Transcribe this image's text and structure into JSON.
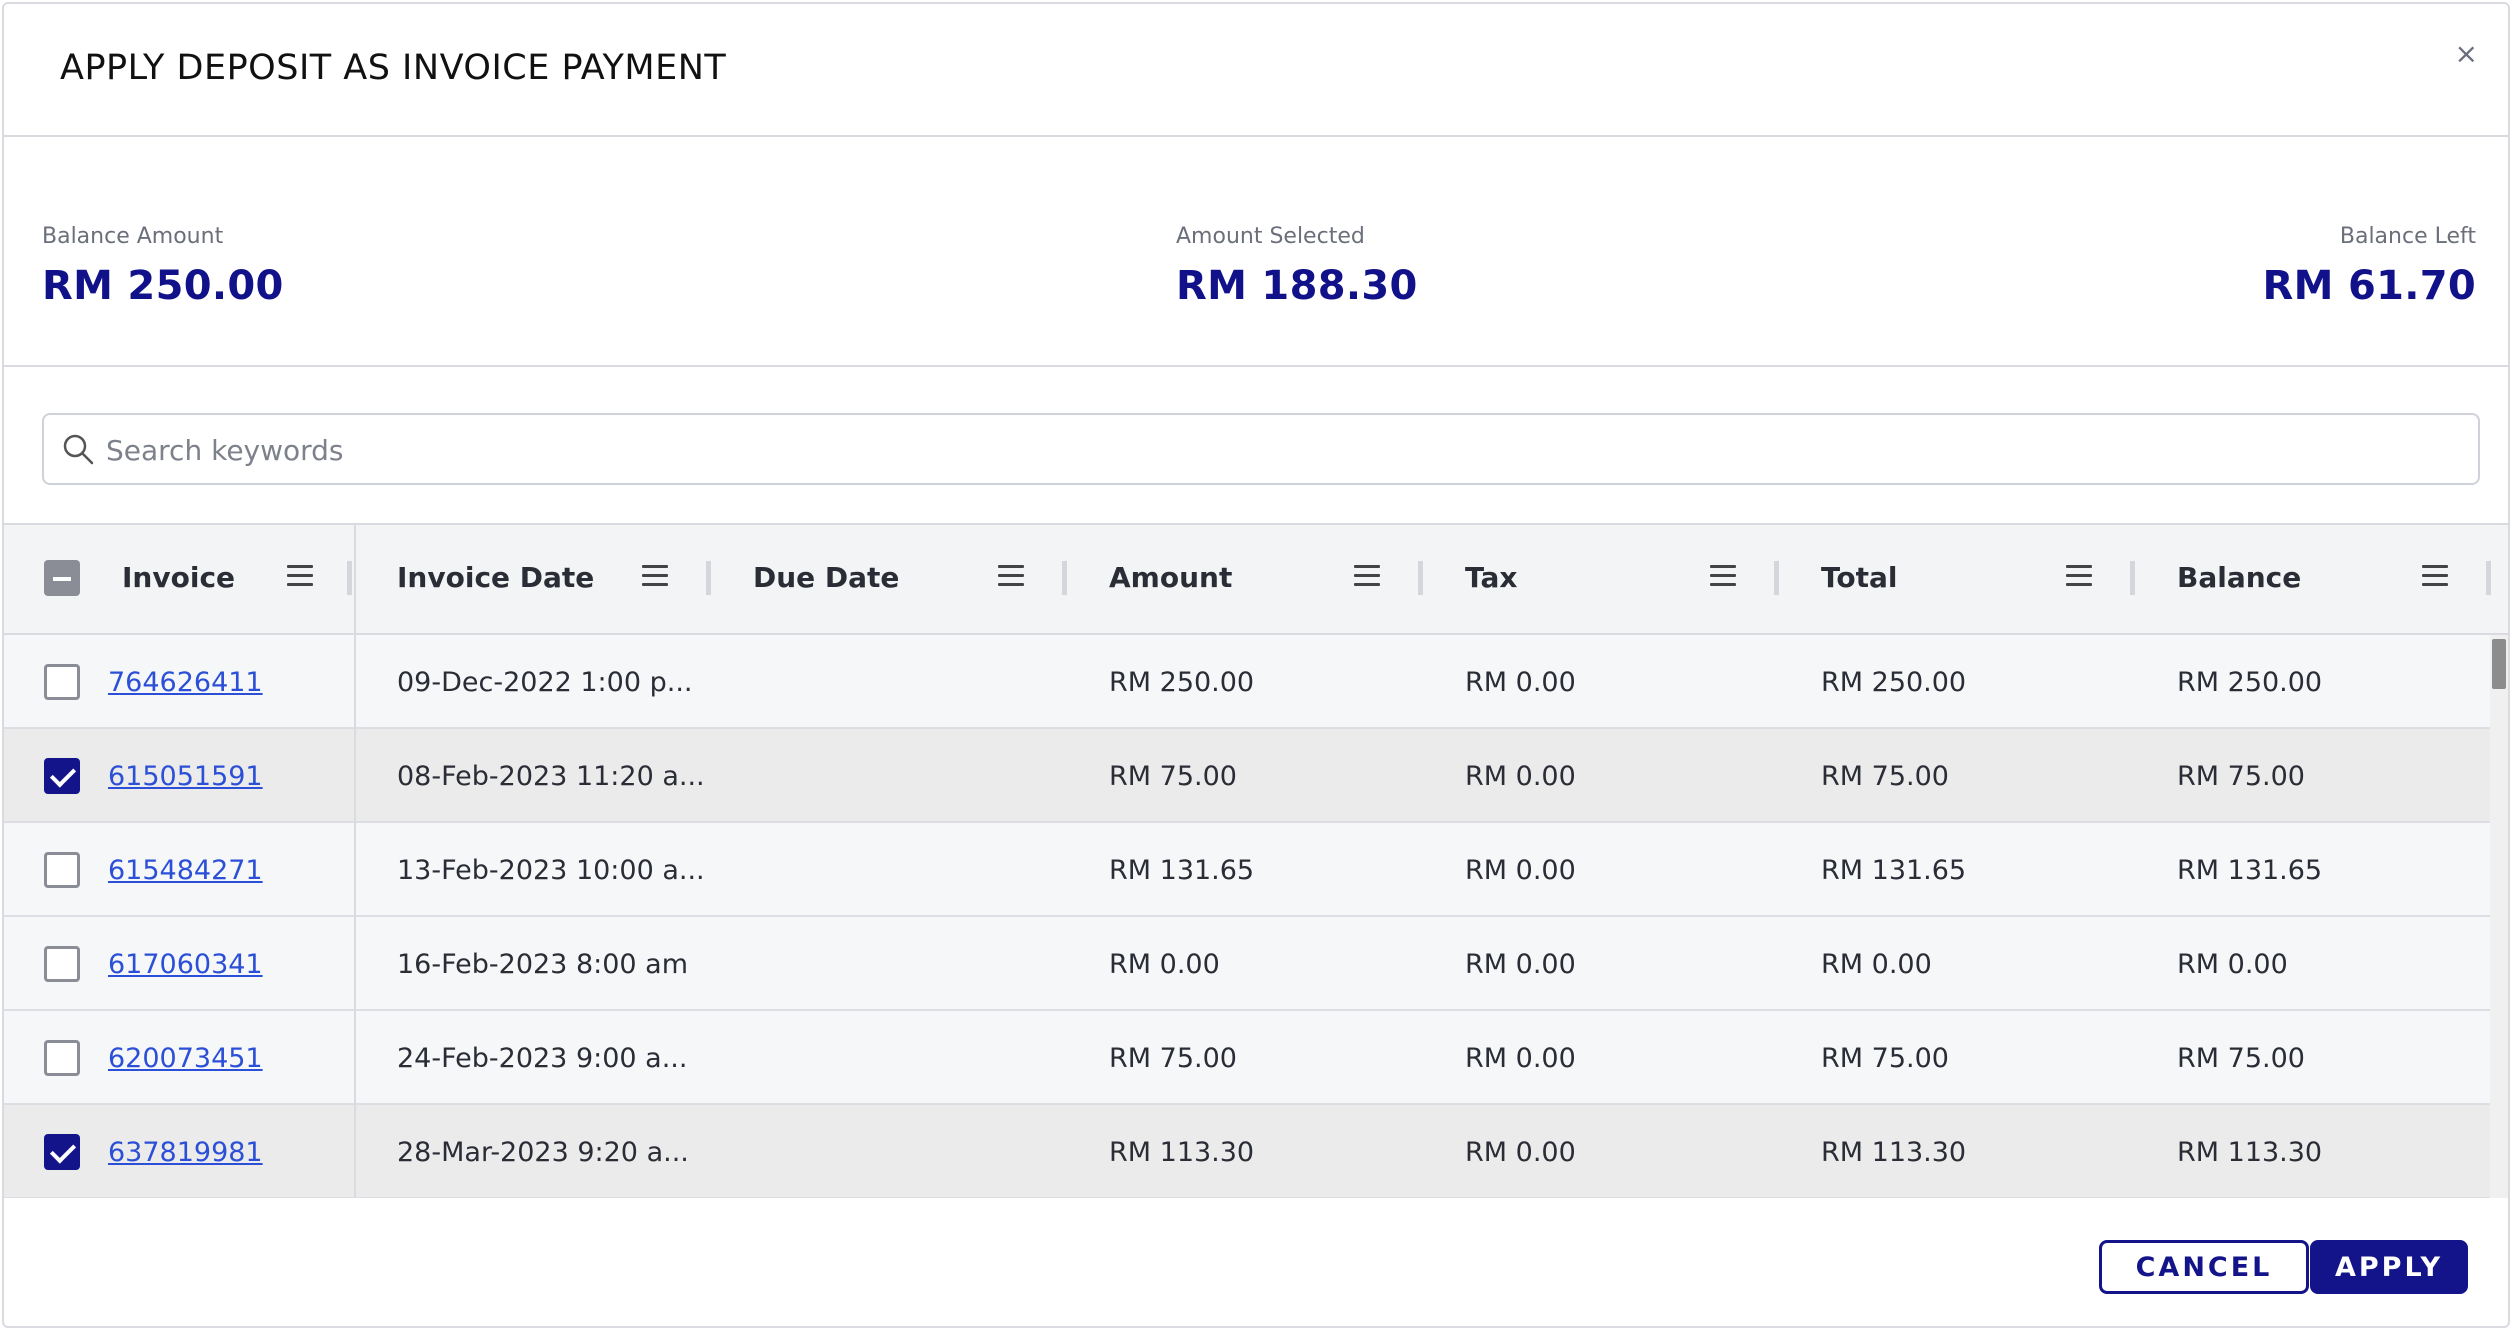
{
  "dialog": {
    "title": "APPLY DEPOSIT AS INVOICE PAYMENT",
    "close_label": "×"
  },
  "summary": {
    "balance_amount": {
      "label": "Balance Amount",
      "value": "RM 250.00"
    },
    "amount_selected": {
      "label": "Amount Selected",
      "value": "RM 188.30"
    },
    "balance_left": {
      "label": "Balance Left",
      "value": "RM 61.70"
    }
  },
  "search": {
    "placeholder": "Search keywords",
    "value": ""
  },
  "table": {
    "select_all_state": "indeterminate",
    "columns": [
      "Invoice",
      "Invoice Date",
      "Due Date",
      "Amount",
      "Tax",
      "Total",
      "Balance"
    ],
    "rows": [
      {
        "selected": false,
        "invoice": "764626411",
        "invoice_date": "09-Dec-2022 1:00 p...",
        "due_date": "",
        "amount": "RM 250.00",
        "tax": "RM 0.00",
        "total": "RM 250.00",
        "balance": "RM 250.00"
      },
      {
        "selected": true,
        "invoice": "615051591",
        "invoice_date": "08-Feb-2023 11:20 a...",
        "due_date": "",
        "amount": "RM 75.00",
        "tax": "RM 0.00",
        "total": "RM 75.00",
        "balance": "RM 75.00"
      },
      {
        "selected": false,
        "invoice": "615484271",
        "invoice_date": "13-Feb-2023 10:00 a...",
        "due_date": "",
        "amount": "RM 131.65",
        "tax": "RM 0.00",
        "total": "RM 131.65",
        "balance": "RM 131.65"
      },
      {
        "selected": false,
        "invoice": "617060341",
        "invoice_date": "16-Feb-2023 8:00 am",
        "due_date": "",
        "amount": "RM 0.00",
        "tax": "RM 0.00",
        "total": "RM 0.00",
        "balance": "RM 0.00"
      },
      {
        "selected": false,
        "invoice": "620073451",
        "invoice_date": "24-Feb-2023 9:00 a...",
        "due_date": "",
        "amount": "RM 75.00",
        "tax": "RM 0.00",
        "total": "RM 75.00",
        "balance": "RM 75.00"
      },
      {
        "selected": true,
        "invoice": "637819981",
        "invoice_date": "28-Mar-2023 9:20 a...",
        "due_date": "",
        "amount": "RM 113.30",
        "tax": "RM 0.00",
        "total": "RM 113.30",
        "balance": "RM 113.30"
      }
    ]
  },
  "footer": {
    "cancel_label": "CANCEL",
    "apply_label": "APPLY"
  },
  "colors": {
    "accent": "#14148a",
    "link": "#2b4fd6",
    "selected_row": "#ebebeb"
  }
}
